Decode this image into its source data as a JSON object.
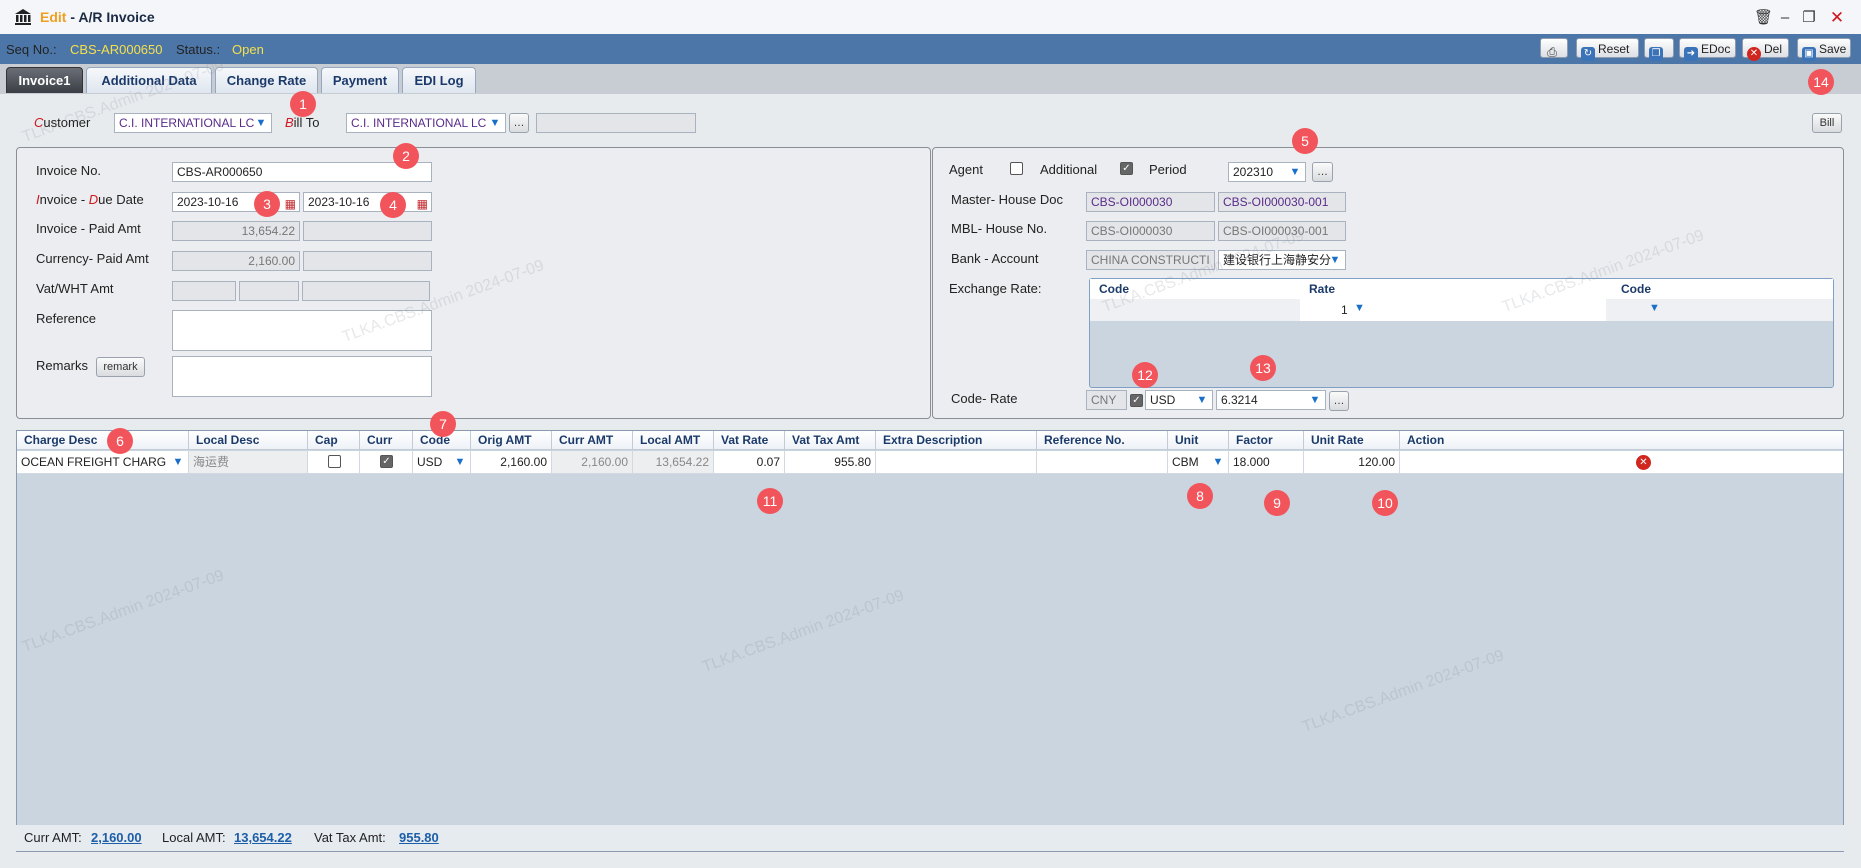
{
  "window": {
    "mode": "Edit",
    "separator": " - ",
    "title": "A/R Invoice"
  },
  "status": {
    "seq_label": "Seq No.:",
    "seq_value": "CBS-AR000650",
    "status_label": "Status.:",
    "status_value": "Open"
  },
  "toolbar": {
    "reset": "Reset",
    "edoc": "EDoc",
    "del": "Del",
    "save": "Save"
  },
  "tabs": [
    "Invoice1",
    "Additional Data",
    "Change Rate",
    "Payment",
    "EDI Log"
  ],
  "customer": {
    "customer_label_first": "C",
    "customer_label_rest": "ustomer",
    "customer_value": "C.I. INTERNATIONAL LC",
    "billto_label_first": "B",
    "billto_label_rest": "ill To",
    "billto_value": "C.I. INTERNATIONAL LC",
    "bill_button": "Bill"
  },
  "left_form": {
    "invoice_no_label": "Invoice No.",
    "invoice_no": "CBS-AR000650",
    "date_label_i": "I",
    "date_label_mid": "nvoice - ",
    "date_label_d": "D",
    "date_label_end": "ue Date",
    "invoice_date": "2023-10-16",
    "due_date": "2023-10-16",
    "paid_label": "Invoice - Paid Amt",
    "invoice_amt": "13,654.22",
    "currency_label": "Currency- Paid Amt",
    "currency_amt": "2,160.00",
    "vat_label": "Vat/WHT Amt",
    "reference_label": "Reference",
    "remarks_label": "Remarks",
    "remark_button": "remark"
  },
  "right_form": {
    "agent_label": "Agent",
    "agent_checked": false,
    "additional_label": "Additional",
    "additional_checked": true,
    "period_label": "Period",
    "period_value": "202310",
    "master_label": "Master- House Doc",
    "master_doc": "CBS-OI000030",
    "house_doc": "CBS-OI000030-001",
    "mbl_label": "MBL- House No.",
    "mbl_no": "CBS-OI000030",
    "house_no": "CBS-OI000030-001",
    "bank_label": "Bank - Account",
    "bank": "CHINA CONSTRUCTI",
    "account": "建设银行上海静安分",
    "exchange_label": "Exchange Rate:",
    "exchange_cols": [
      "Code",
      "Rate",
      "Code"
    ],
    "exchange_row_rate": "1",
    "code_rate_label": "Code- Rate",
    "base_currency": "CNY",
    "code_checked": true,
    "code_value": "USD",
    "rate_value": "6.3214"
  },
  "charges": {
    "columns": [
      "Charge Desc",
      "Local Desc",
      "Cap",
      "Curr",
      "Code",
      "Orig AMT",
      "Curr AMT",
      "Local AMT",
      "Vat Rate",
      "Vat Tax Amt",
      "Extra Description",
      "Reference No.",
      "Unit",
      "Factor",
      "Unit Rate",
      "Action"
    ],
    "rows": [
      {
        "charge_desc": "OCEAN FREIGHT CHARG",
        "local_desc": "海运费",
        "cap": false,
        "curr": true,
        "code": "USD",
        "orig_amt": "2,160.00",
        "curr_amt": "2,160.00",
        "local_amt": "13,654.22",
        "vat_rate": "0.07",
        "vat_tax_amt": "955.80",
        "extra_description": "",
        "reference_no": "",
        "unit": "CBM",
        "factor": "18.000",
        "unit_rate": "120.00"
      }
    ]
  },
  "totals": {
    "curr_label": "Curr AMT:",
    "curr_value": "2,160.00",
    "local_label": "Local AMT:",
    "local_value": "13,654.22",
    "vat_label": "Vat Tax Amt:",
    "vat_value": "955.80"
  },
  "badges": [
    "1",
    "2",
    "3",
    "4",
    "5",
    "6",
    "7",
    "8",
    "9",
    "10",
    "11",
    "12",
    "13",
    "14"
  ],
  "colors": {
    "status_bar": "#4d76a8",
    "status_value": "#f5e04a",
    "badge": "#f2545b",
    "mode_text": "#f0a020"
  },
  "watermark": "TLKA.CBS.Admin 2024-07-09"
}
